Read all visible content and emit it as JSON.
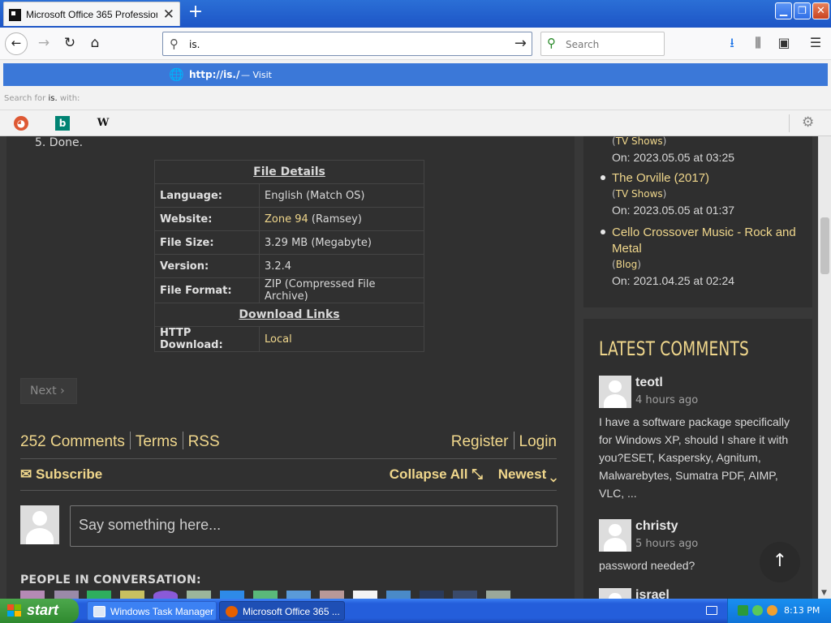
{
  "browser": {
    "tab_title": "Microsoft Office 365 Professional P",
    "tab_close": "✕",
    "new_tab": "+",
    "url_value": "is.",
    "search_placeholder": "Search"
  },
  "window_controls": {
    "minimize": "▁",
    "maximize": "❐",
    "close": "✕"
  },
  "toolbar_icons": [
    "back-icon",
    "forward-icon",
    "reload-icon",
    "home-icon",
    "download-icon",
    "library-icon",
    "sidebar-icon",
    "menu-icon"
  ],
  "dropdown": {
    "url": "http://is./",
    "visit": "— Visit",
    "search_for_prefix": "Search for",
    "search_for_term": "is.",
    "search_for_suffix": "with:",
    "engines": [
      "duckduckgo-icon",
      "bing-icon",
      "wikipedia-icon"
    ],
    "wiki_glyph": "W",
    "bing_glyph": "b"
  },
  "article": {
    "step": "5. Done.",
    "file_details_title": "File Details",
    "rows": [
      {
        "key": "Language:",
        "value": "English (Match OS)"
      },
      {
        "key": "Website:",
        "value_link": "Zone 94",
        "value_rest": " (Ramsey)"
      },
      {
        "key": "File Size:",
        "value": "3.29 MB (Megabyte)"
      },
      {
        "key": "Version:",
        "value": "3.2.4"
      },
      {
        "key": "File Format:",
        "value": "ZIP (Compressed File Archive)"
      }
    ],
    "download_links_title": "Download Links",
    "download_row": {
      "key": "HTTP Download:",
      "value": "Local"
    },
    "next_button": "Next"
  },
  "comments": {
    "count_link": "252 Comments",
    "terms": "Terms",
    "rss": "RSS",
    "register": "Register",
    "login": "Login",
    "subscribe": "Subscribe",
    "collapse_all": "Collapse All",
    "sort": "Newest",
    "placeholder": "Say something here...",
    "people_label": "PEOPLE IN CONVERSATION:"
  },
  "sidebar": {
    "recent": [
      {
        "title": "",
        "category": "TV Shows",
        "date": "On: 2023.05.05 at 03:25"
      },
      {
        "title": "The Orville (2017)",
        "category": "TV Shows",
        "date": "On: 2023.05.05 at 01:37"
      },
      {
        "title": "Cello Crossover Music - Rock and Metal",
        "category": "Blog",
        "date": "On: 2021.04.25 at 02:24"
      }
    ],
    "latest_comments_title": "LATEST COMMENTS",
    "latest_comments": [
      {
        "name": "teotl",
        "ago": "4 hours ago",
        "text": "I have a software package specifically for Windows XP, should I share it with you?ESET, Kaspersky, Agnitum, Malwarebytes, Sumatra PDF, AIMP, VLC, ..."
      },
      {
        "name": "christy",
        "ago": "5 hours ago",
        "text": "password needed?"
      },
      {
        "name": "israel",
        "ago": "",
        "text": ""
      }
    ]
  },
  "taskbar": {
    "start": "start",
    "items": [
      {
        "label": "Windows Task Manager",
        "icon": "task-manager-icon"
      },
      {
        "label": "Microsoft Office 365 ...",
        "icon": "firefox-icon"
      }
    ],
    "clock": "8:13 PM"
  },
  "colors": {
    "accent_gold": "#f0d78c",
    "page_bg": "#383838",
    "panel_bg": "#2f2f2f",
    "dropdown_highlight": "#3b78d8",
    "xp_taskbar": "#245edb",
    "xp_start": "#3c9a3c"
  }
}
